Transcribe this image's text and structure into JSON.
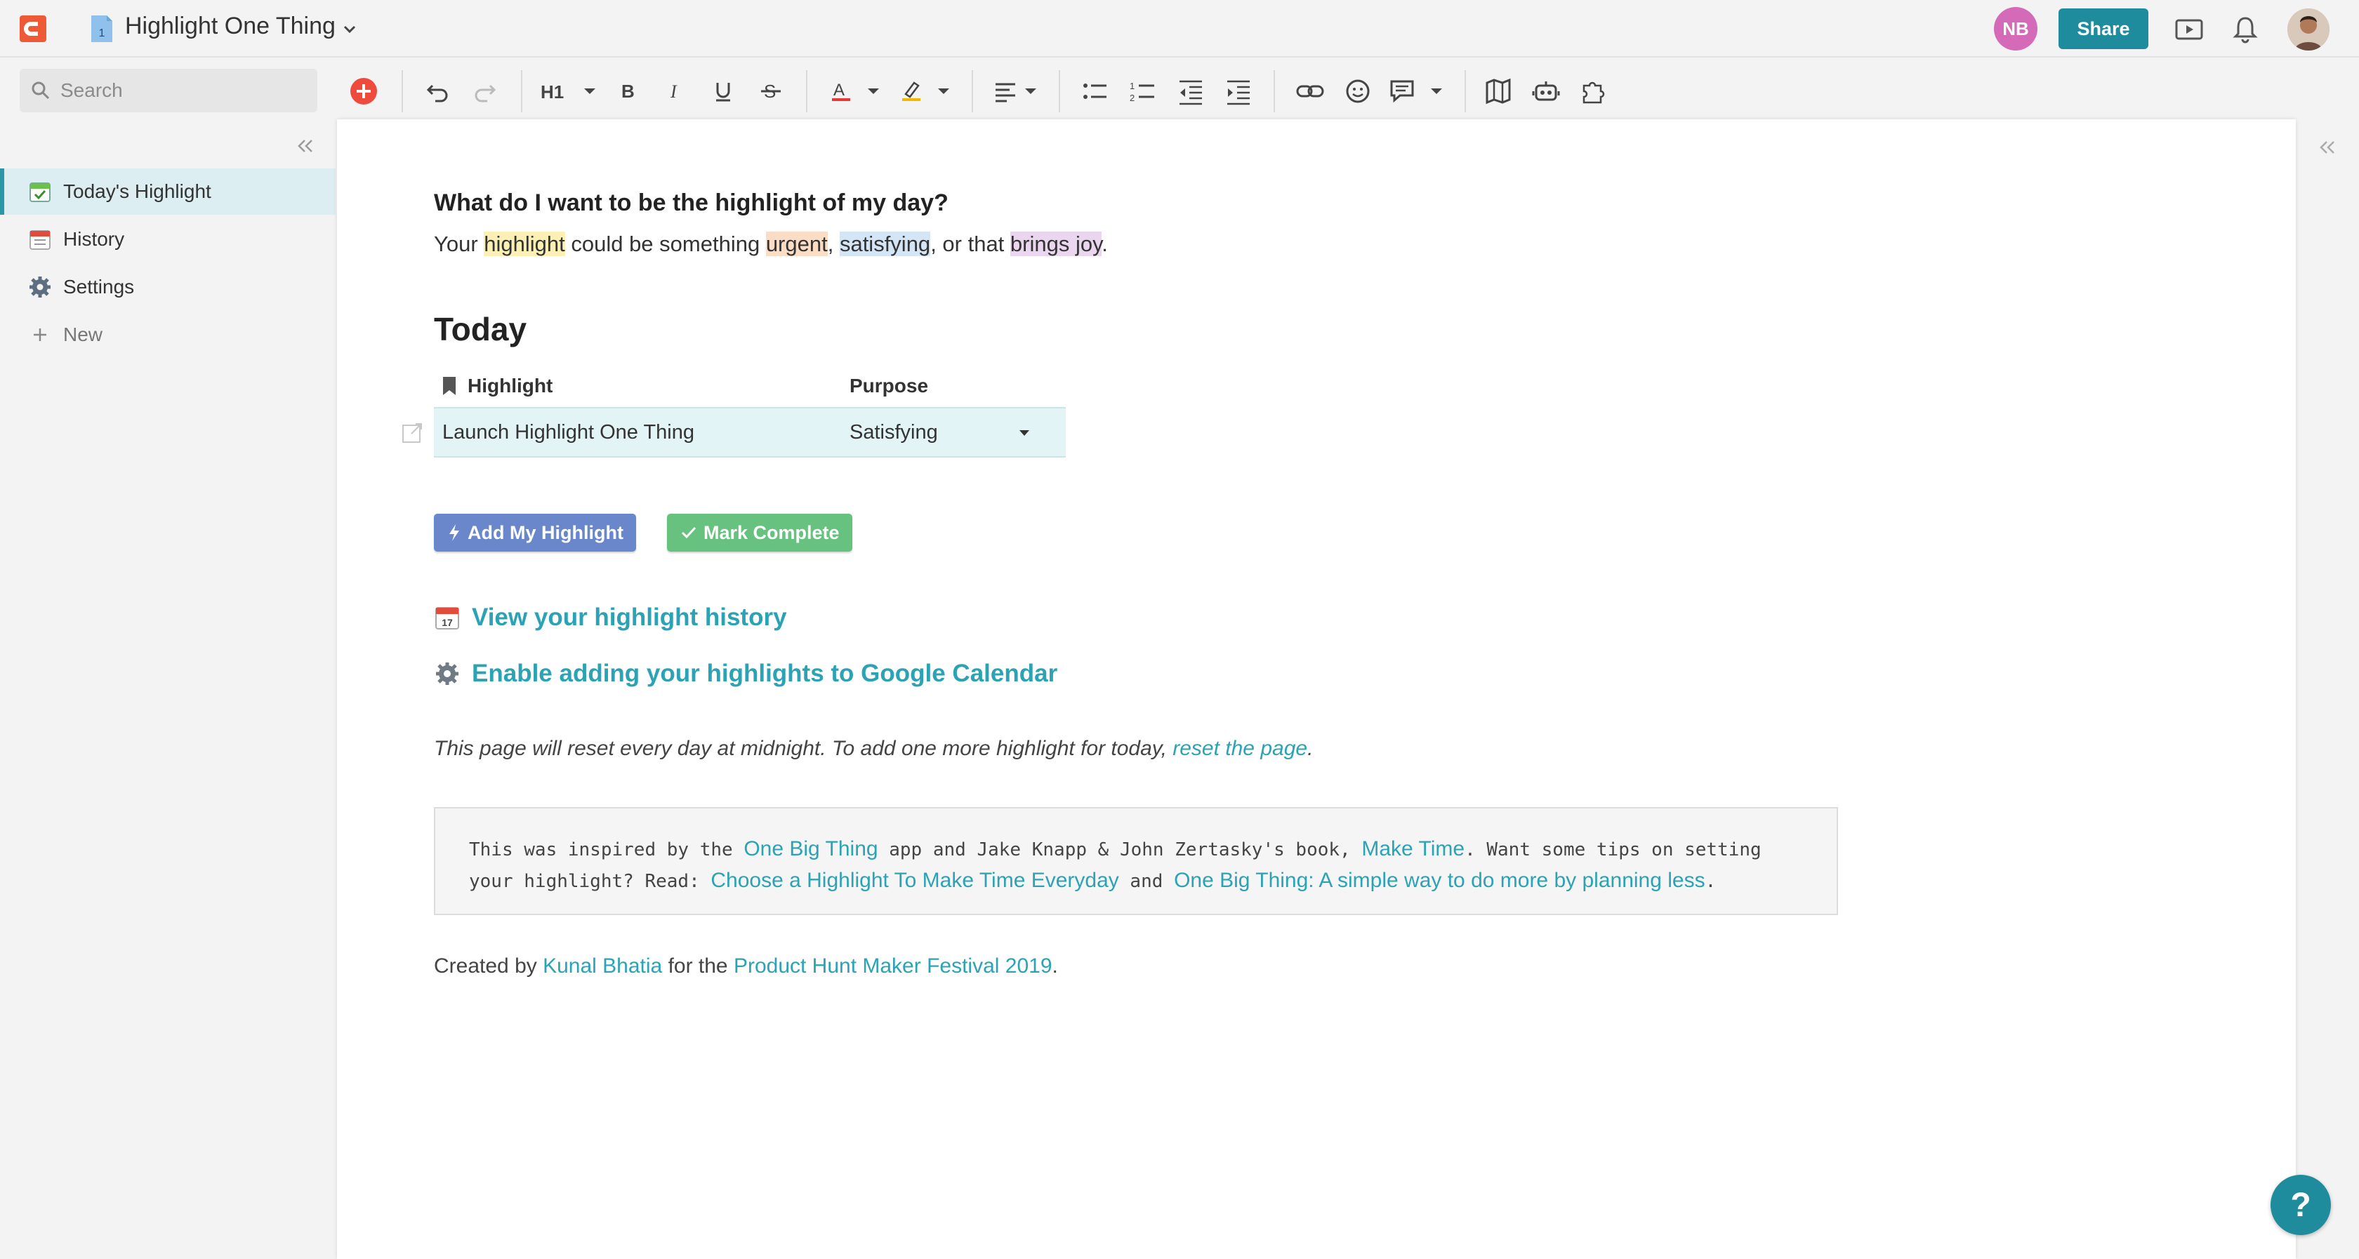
{
  "app": {
    "doc_title": "Highlight One Thing",
    "doc_icon_number": "1",
    "avatar_initials": "NB",
    "share_label": "Share"
  },
  "toolbar": {
    "search_placeholder": "Search",
    "heading_label": "H1"
  },
  "sidebar": {
    "items": [
      {
        "label": "Today's Highlight",
        "icon": "calendar-check-icon",
        "active": true
      },
      {
        "label": "History",
        "icon": "calendar-icon",
        "active": false
      },
      {
        "label": "Settings",
        "icon": "gear-icon",
        "active": false
      },
      {
        "label": "New",
        "icon": "plus-icon",
        "active": false
      }
    ]
  },
  "page": {
    "question": "What do I want to be the highlight of my day?",
    "intro": {
      "t1": "Your ",
      "highlight": "highlight",
      "t2": " could be something ",
      "urgent": "urgent",
      "t3": ", ",
      "satisfying": "satisfying",
      "t4": ", or that ",
      "brings_joy": "brings joy",
      "t5": "."
    },
    "today_heading": "Today",
    "table": {
      "col_highlight": "Highlight",
      "col_purpose": "Purpose",
      "rows": [
        {
          "highlight": "Launch Highlight One Thing",
          "purpose": "Satisfying"
        }
      ]
    },
    "buttons": {
      "add": "Add My Highlight",
      "complete": "Mark Complete"
    },
    "links": {
      "history": "View your highlight history",
      "calendar": "Enable adding your highlights to Google Calendar"
    },
    "note": {
      "text": "This page will reset every day at midnight. To add one more highlight for today, ",
      "link": "reset the page",
      "end": "."
    },
    "inspired": {
      "t1": "This was inspired by the ",
      "l1": "One Big Thing",
      "t2": " app and Jake Knapp & John Zertasky's book, ",
      "l2": "Make Time",
      "t3": ". Want some tips on setting",
      "t4": "your highlight? Read: ",
      "l3": "Choose a Highlight To Make Time Everyday",
      "t5": " and ",
      "l4": "One Big Thing: A simple way to do more by planning less",
      "t6": "."
    },
    "credit": {
      "t1": "Created by ",
      "l1": "Kunal Bhatia",
      "t2": " for the ",
      "l2": "Product Hunt Maker Festival 2019",
      "t3": "."
    }
  },
  "help_label": "?",
  "colors": {
    "accent": "#1e8c9c",
    "link": "#2ba3b4",
    "button_blue": "#6a87cc",
    "button_green": "#66c27e"
  }
}
